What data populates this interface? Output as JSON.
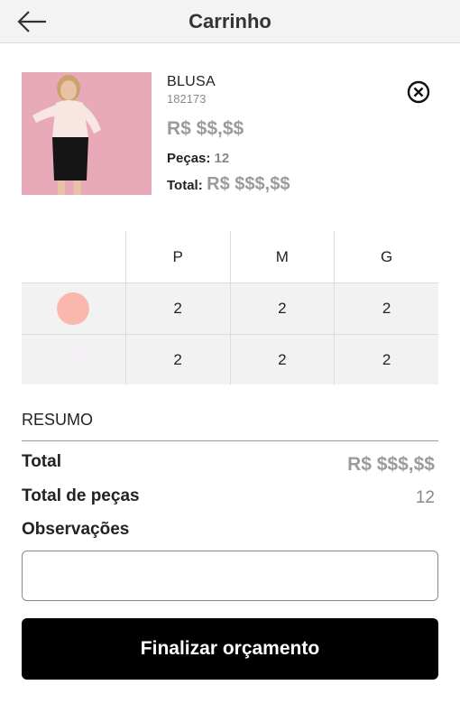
{
  "header": {
    "title": "Carrinho",
    "back_icon": "arrow-left-icon"
  },
  "product": {
    "name": "BLUSA",
    "code": "182173",
    "price": "R$ $$,$$",
    "pieces_label": "Peças:",
    "pieces_value": "12",
    "total_label": "Total:",
    "total_value": "R$ $$$,$$",
    "remove_icon": "close-circle-icon",
    "image_colors": {
      "background": "#e8a9b8",
      "blouse": "#f7e6e2",
      "skirt": "#151515",
      "skin": "#e9c1a4",
      "hair": "#c9a36b"
    }
  },
  "size_grid": {
    "sizes": [
      "P",
      "M",
      "G"
    ],
    "rows": [
      {
        "color": "#f9b7ae",
        "quantities": [
          "2",
          "2",
          "2"
        ]
      },
      {
        "color": "#f4f1f4",
        "quantities": [
          "2",
          "2",
          "2"
        ]
      }
    ]
  },
  "summary": {
    "title": "RESUMO",
    "total_label": "Total",
    "total_value": "R$ $$$,$$",
    "pieces_label": "Total de peças",
    "pieces_value": "12",
    "observations_label": "Observações",
    "observations_value": ""
  },
  "submit_button": {
    "label": "Finalizar orçamento"
  }
}
